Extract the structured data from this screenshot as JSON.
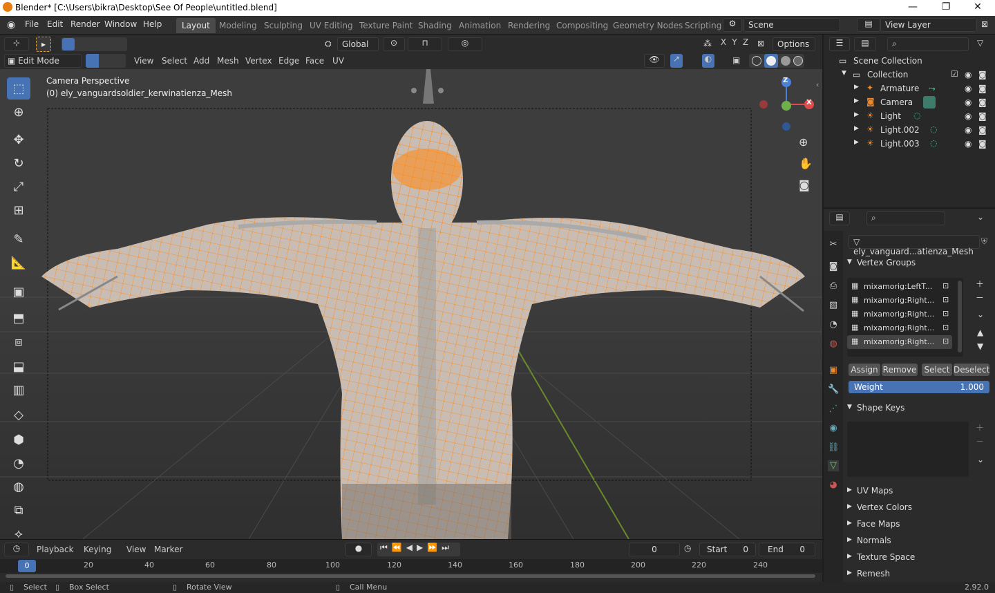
{
  "window": {
    "title": "Blender* [C:\\Users\\bikra\\Desktop\\See Of People\\untitled.blend]",
    "minimize": "—",
    "maximize": "❐",
    "close": "✕"
  },
  "menu": [
    "File",
    "Edit",
    "Render",
    "Window",
    "Help"
  ],
  "workspaces": [
    "Layout",
    "Modeling",
    "Sculpting",
    "UV Editing",
    "Texture Paint",
    "Shading",
    "Animation",
    "Rendering",
    "Compositing",
    "Geometry Nodes",
    "Scripting"
  ],
  "active_workspace": "Layout",
  "scene": {
    "label": "Scene",
    "view_layer": "View Layer"
  },
  "viewport_header": {
    "transform_orientation": "Global",
    "options": "Options",
    "axes": [
      "X",
      "Y",
      "Z"
    ],
    "mode": "Edit Mode",
    "menus": [
      "View",
      "Select",
      "Add",
      "Mesh",
      "Vertex",
      "Edge",
      "Face",
      "UV"
    ]
  },
  "viewport": {
    "camera_label": "Camera Perspective",
    "object_label": "(0) ely_vanguardsoldier_kerwinatienza_Mesh",
    "gizmo": {
      "z": "Z",
      "x": "X"
    }
  },
  "outliner": {
    "scene_collection": "Scene Collection",
    "collection": "Collection",
    "items": [
      "Armature",
      "Camera",
      "Light",
      "Light.002",
      "Light.003"
    ]
  },
  "properties": {
    "mesh_name": "ely_vanguard...atienza_Mesh",
    "vertex_groups_title": "Vertex Groups",
    "vertex_groups": [
      "mixamorig:LeftT...",
      "mixamorig:Right...",
      "mixamorig:Right...",
      "mixamorig:Right...",
      "mixamorig:Right..."
    ],
    "buttons": {
      "assign": "Assign",
      "remove": "Remove",
      "select": "Select",
      "deselect": "Deselect"
    },
    "weight_label": "Weight",
    "weight_value": "1.000",
    "weight_fraction": 1.0,
    "shape_keys_title": "Shape Keys",
    "collapsed_panels": [
      "UV Maps",
      "Vertex Colors",
      "Face Maps",
      "Normals",
      "Texture Space",
      "Remesh"
    ]
  },
  "timeline": {
    "menus": [
      "Playback",
      "Keying",
      "View",
      "Marker"
    ],
    "current_frame": "0",
    "start_label": "Start",
    "start_value": "0",
    "end_label": "End",
    "end_value": "0",
    "ticks": [
      "0",
      "20",
      "40",
      "60",
      "80",
      "100",
      "120",
      "140",
      "160",
      "180",
      "200",
      "220",
      "240"
    ]
  },
  "status": {
    "select": "Select",
    "box_select": "Box Select",
    "rotate_view": "Rotate View",
    "call_menu": "Call Menu",
    "version": "2.92.0"
  },
  "colors": {
    "accent": "#4772b3",
    "selection_orange": "#ff8a1a",
    "skin": "#c9bdb3"
  }
}
